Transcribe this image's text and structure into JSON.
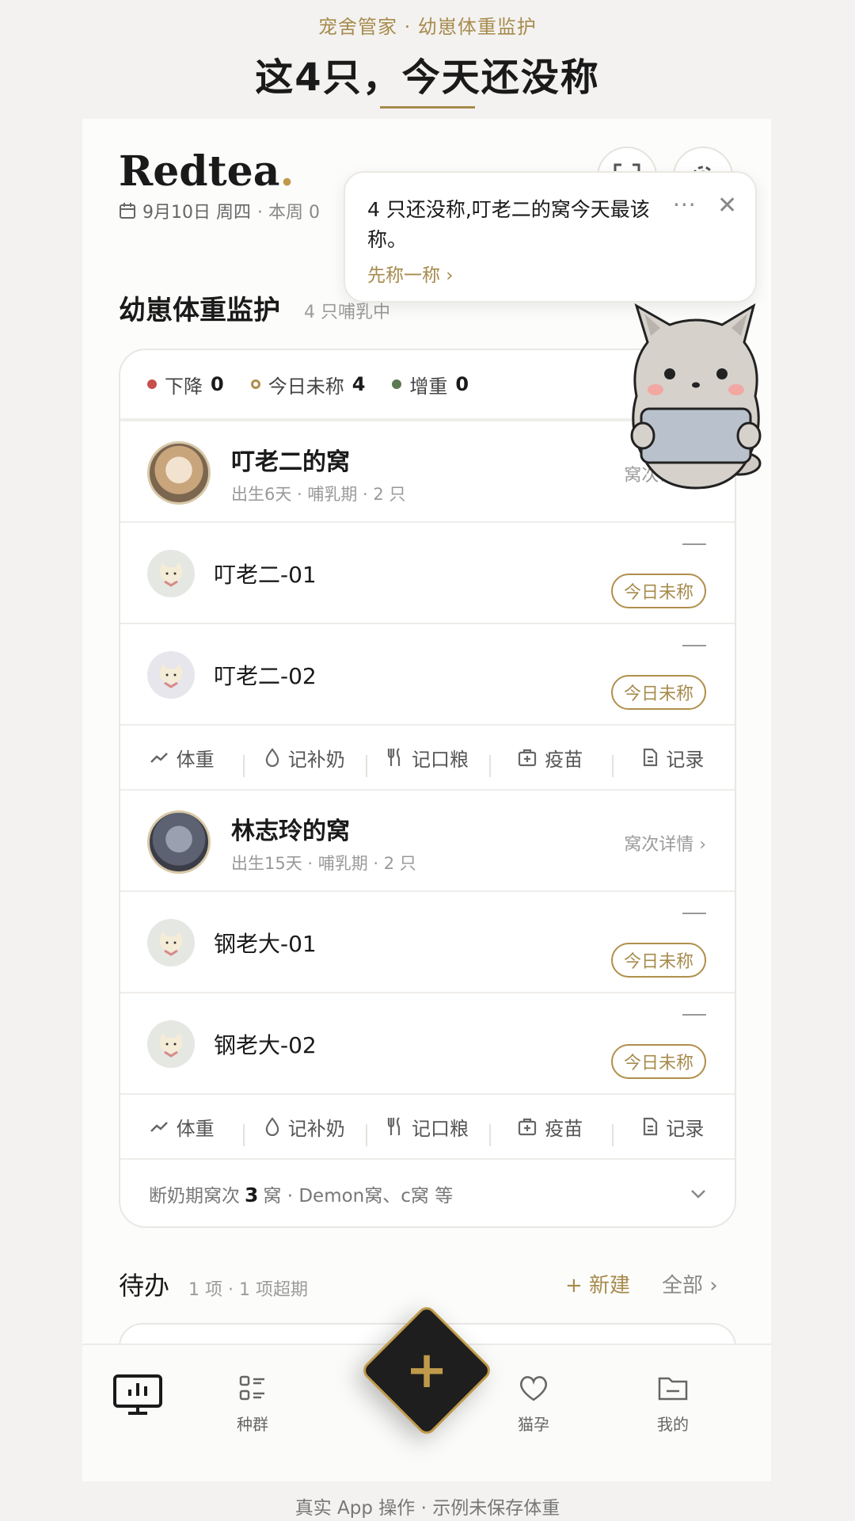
{
  "caption": {
    "top": "宠舍管家 ·  幼崽体重监护",
    "bottom": "真实 App 操作 ·  示例未保存体重"
  },
  "headline": "这4只，今天还没称",
  "header": {
    "brand": "Redtea",
    "brand_dot": ".",
    "date": "9月10日 周四",
    "week_text": "· 本周 0"
  },
  "section": {
    "title": "幼崽体重监护",
    "subtitle": "4 只哺乳中"
  },
  "legend": [
    {
      "label": "下降",
      "count": "0",
      "color": "#c8514e"
    },
    {
      "label": "今日未称",
      "count": "4",
      "color": "#b08f4b"
    },
    {
      "label": "增重",
      "count": "0",
      "color": "#5b7a52"
    }
  ],
  "litters": [
    {
      "name": "叮老二的窝",
      "meta": "出生6天 · 哺乳期 · 2 只",
      "link": "窝次详情 ›",
      "kits": [
        {
          "name": "叮老二-01",
          "weight": "—",
          "status": "今日未称"
        },
        {
          "name": "叮老二-02",
          "weight": "—",
          "status": "今日未称"
        }
      ]
    },
    {
      "name": "林志玲的窝",
      "meta": "出生15天 · 哺乳期 · 2 只",
      "link": "窝次详情 ›",
      "kits": [
        {
          "name": "钢老大-01",
          "weight": "—",
          "status": "今日未称"
        },
        {
          "name": "钢老大-02",
          "weight": "—",
          "status": "今日未称"
        }
      ]
    }
  ],
  "actions": [
    "体重",
    "记补奶",
    "记口粮",
    "疫苗",
    "记录"
  ],
  "weaning": {
    "prefix": "断奶期窝次",
    "count": "3",
    "suffix": "窝 · Demon窝、c窝 等"
  },
  "todo": {
    "title": "待办",
    "subtitle": "1 项 · 1 项超期",
    "new_label": "+ 新建",
    "all_label": "全部 ›"
  },
  "tabs": [
    {
      "label": "",
      "icon": "dashboard-icon"
    },
    {
      "label": "种群",
      "icon": "list-icon"
    },
    {
      "label": "猫孕",
      "icon": "heart-icon"
    },
    {
      "label": "我的",
      "icon": "folder-icon"
    }
  ],
  "toast": {
    "message": "4 只还没称,叮老二的窝今天最该称。",
    "link": "先称一称 ›",
    "more": "···",
    "close": "✕"
  }
}
